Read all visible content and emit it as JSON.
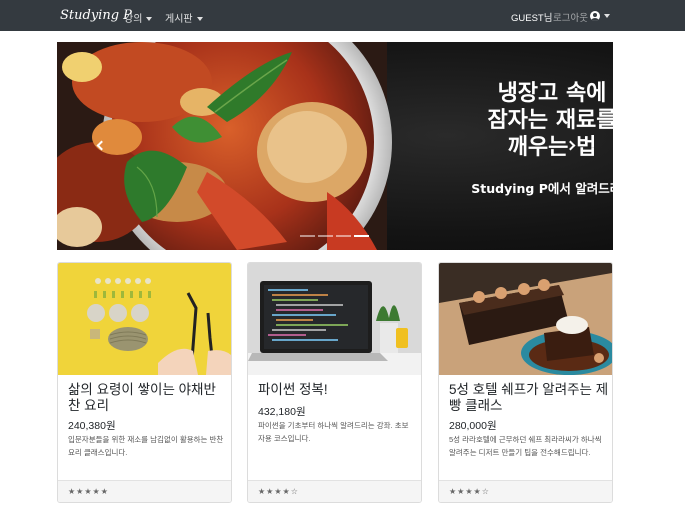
{
  "navbar": {
    "brand": "Studying P",
    "menu_courses": "강의",
    "menu_board": "게시판",
    "guest_label": "GUEST님",
    "logout_label": "로그아웃",
    "user_icon": "user-circle-icon"
  },
  "carousel": {
    "headline_line1": "냉장고 속에",
    "headline_line2": "잠자는 재료를",
    "headline_line3": "깨우는 법",
    "subline": "Studying P에서 알려드려요",
    "slide_count": 4,
    "active_slide": 4
  },
  "cards": [
    {
      "image": "vegetable-cooking-photo",
      "title": "삶의 요령이 쌓이는 야채반찬 요리",
      "price": "240,380원",
      "description": "입문자분들을 위한 재소를 남김없이 활용하는 반찬요리 클래스입니다.",
      "rating": "★★★★★"
    },
    {
      "image": "laptop-code-photo",
      "title": "파이썬 정복!",
      "price": "432,180원",
      "description": "파이썬을 기초부터 하나씩 알려드리는 강좌. 초보자용 코스입니다.",
      "rating": "★★★★☆"
    },
    {
      "image": "chocolate-dessert-photo",
      "title": "5성 호텔 쉐프가 알려주는 제빵 클래스",
      "price": "280,000원",
      "description": "5성 라라호텔에 근무하던 쉐프 최라라씨가 하나씩 알려주는 디저트 만들기 팁을 전수해드립니다.",
      "rating": "★★★★☆"
    }
  ]
}
